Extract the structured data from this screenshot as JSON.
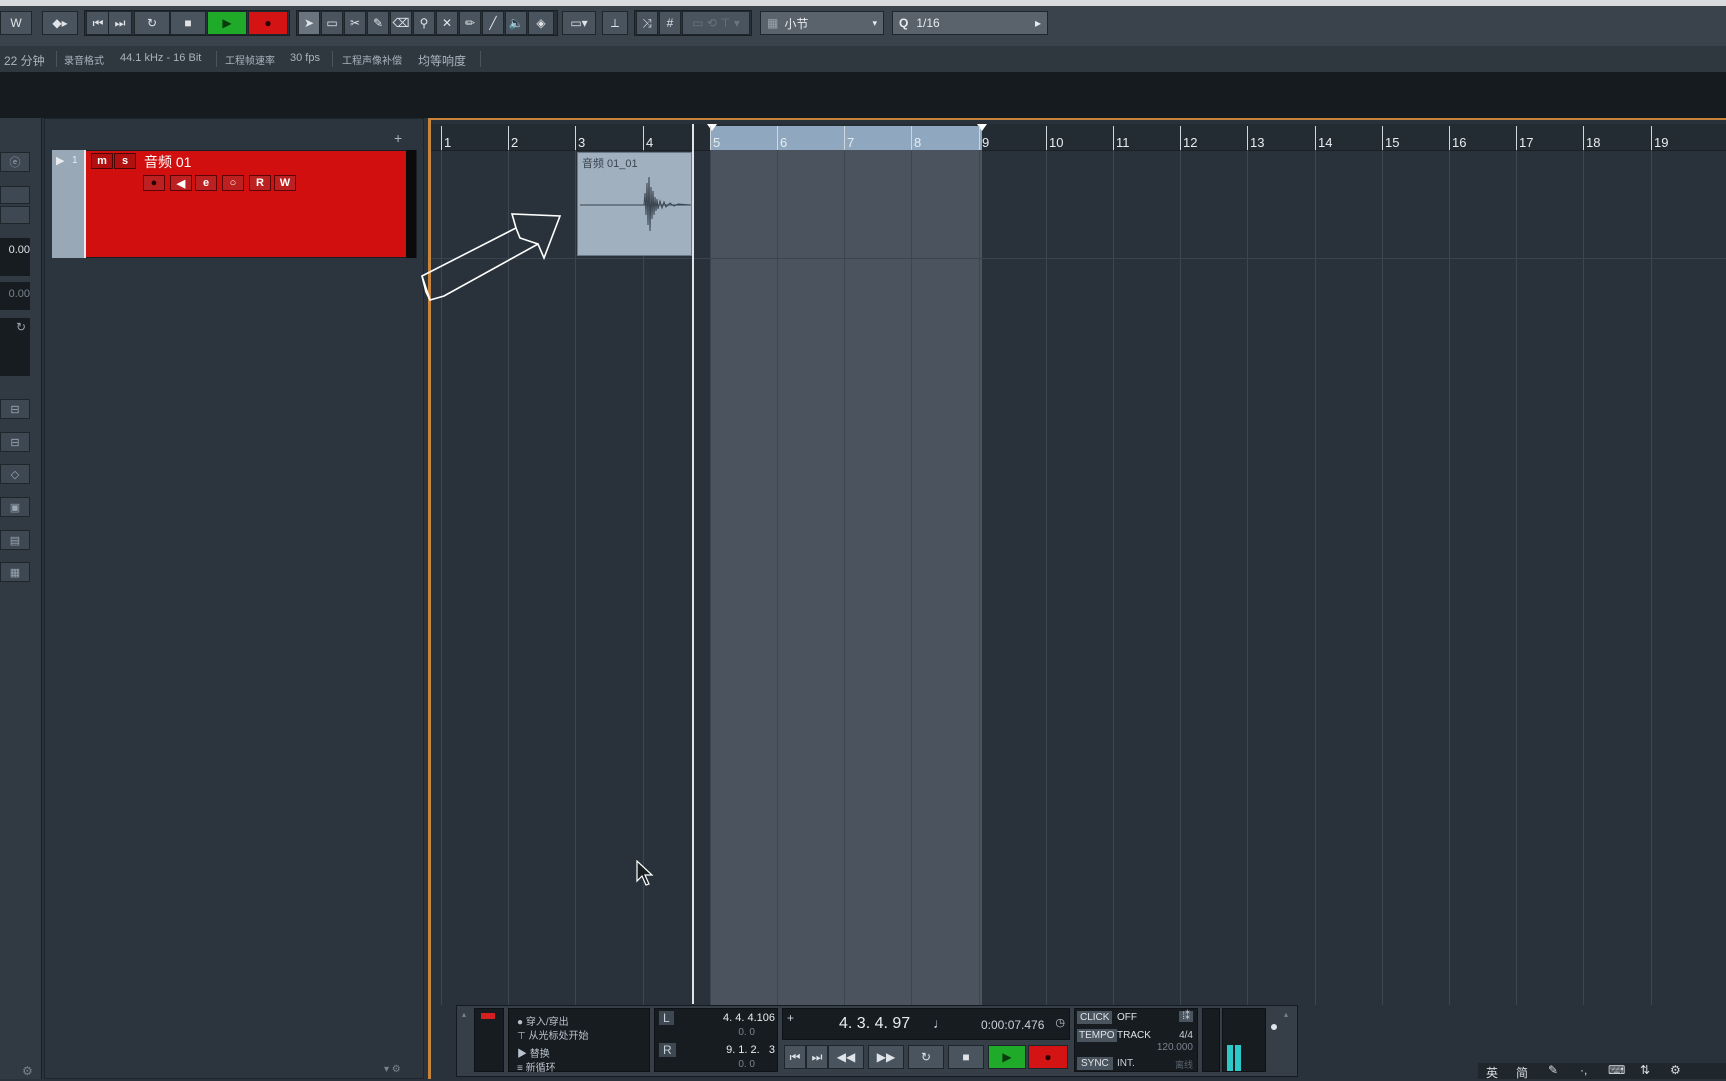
{
  "toolbar": {
    "left_label": "W",
    "snap_type": "小节",
    "quantize_value": "1/16",
    "quantize_prefix": "Q"
  },
  "status": {
    "duration": "22 分钟",
    "record_format_label": "录音格式",
    "record_format": "44.1 kHz - 16 Bit",
    "project_frame_rate_label": "工程帧速率",
    "frame_rate": "30 fps",
    "project_pan_law_label": "工程声像补偿",
    "pan_law": "均等响度"
  },
  "inspector": {
    "value1": "0.00",
    "value2": "0.00"
  },
  "track": {
    "number": "1",
    "name": "音频 01",
    "mute": "m",
    "solo": "s",
    "rec": "●",
    "monitor": "◀",
    "edit": "e",
    "lanes": "○",
    "read": "R",
    "write": "W"
  },
  "clip": {
    "name": "音频 01_01"
  },
  "ruler": {
    "bars": [
      "1",
      "2",
      "3",
      "4",
      "5",
      "6",
      "7",
      "8",
      "9",
      "10",
      "11",
      "12",
      "13",
      "14",
      "15",
      "16",
      "17",
      "18",
      "19"
    ]
  },
  "transport": {
    "punch_in_label": "穿入/穿出",
    "from_cursor_label": "从光标处开始",
    "replace_label": "替换",
    "new_clip_label": "新循环",
    "left_locator": "4. 4. 4.106",
    "left_offset": "0.   0",
    "right_locator": "9. 1. 2.   3",
    "right_offset": "0.   0",
    "position_bars": "4. 3. 4. 97",
    "position_time": "0:00:07.476",
    "L": "L",
    "R": "R",
    "click_label": "CLICK",
    "click_value": "OFF",
    "tempo_label": "TEMPO",
    "tempo_mode": "TRACK",
    "time_signature": "4/4",
    "tempo_value": "120.000",
    "sync_label": "SYNC",
    "sync_value": "INT.",
    "sync_extra": "离线"
  },
  "ime": {
    "lang": "英",
    "mode": "简"
  },
  "colors": {
    "track_red": "#d10f0f",
    "play_green": "#1faa2a",
    "record_red": "#d41414",
    "loop_blue": "#8fa8bf",
    "border_orange": "#c8843a"
  }
}
